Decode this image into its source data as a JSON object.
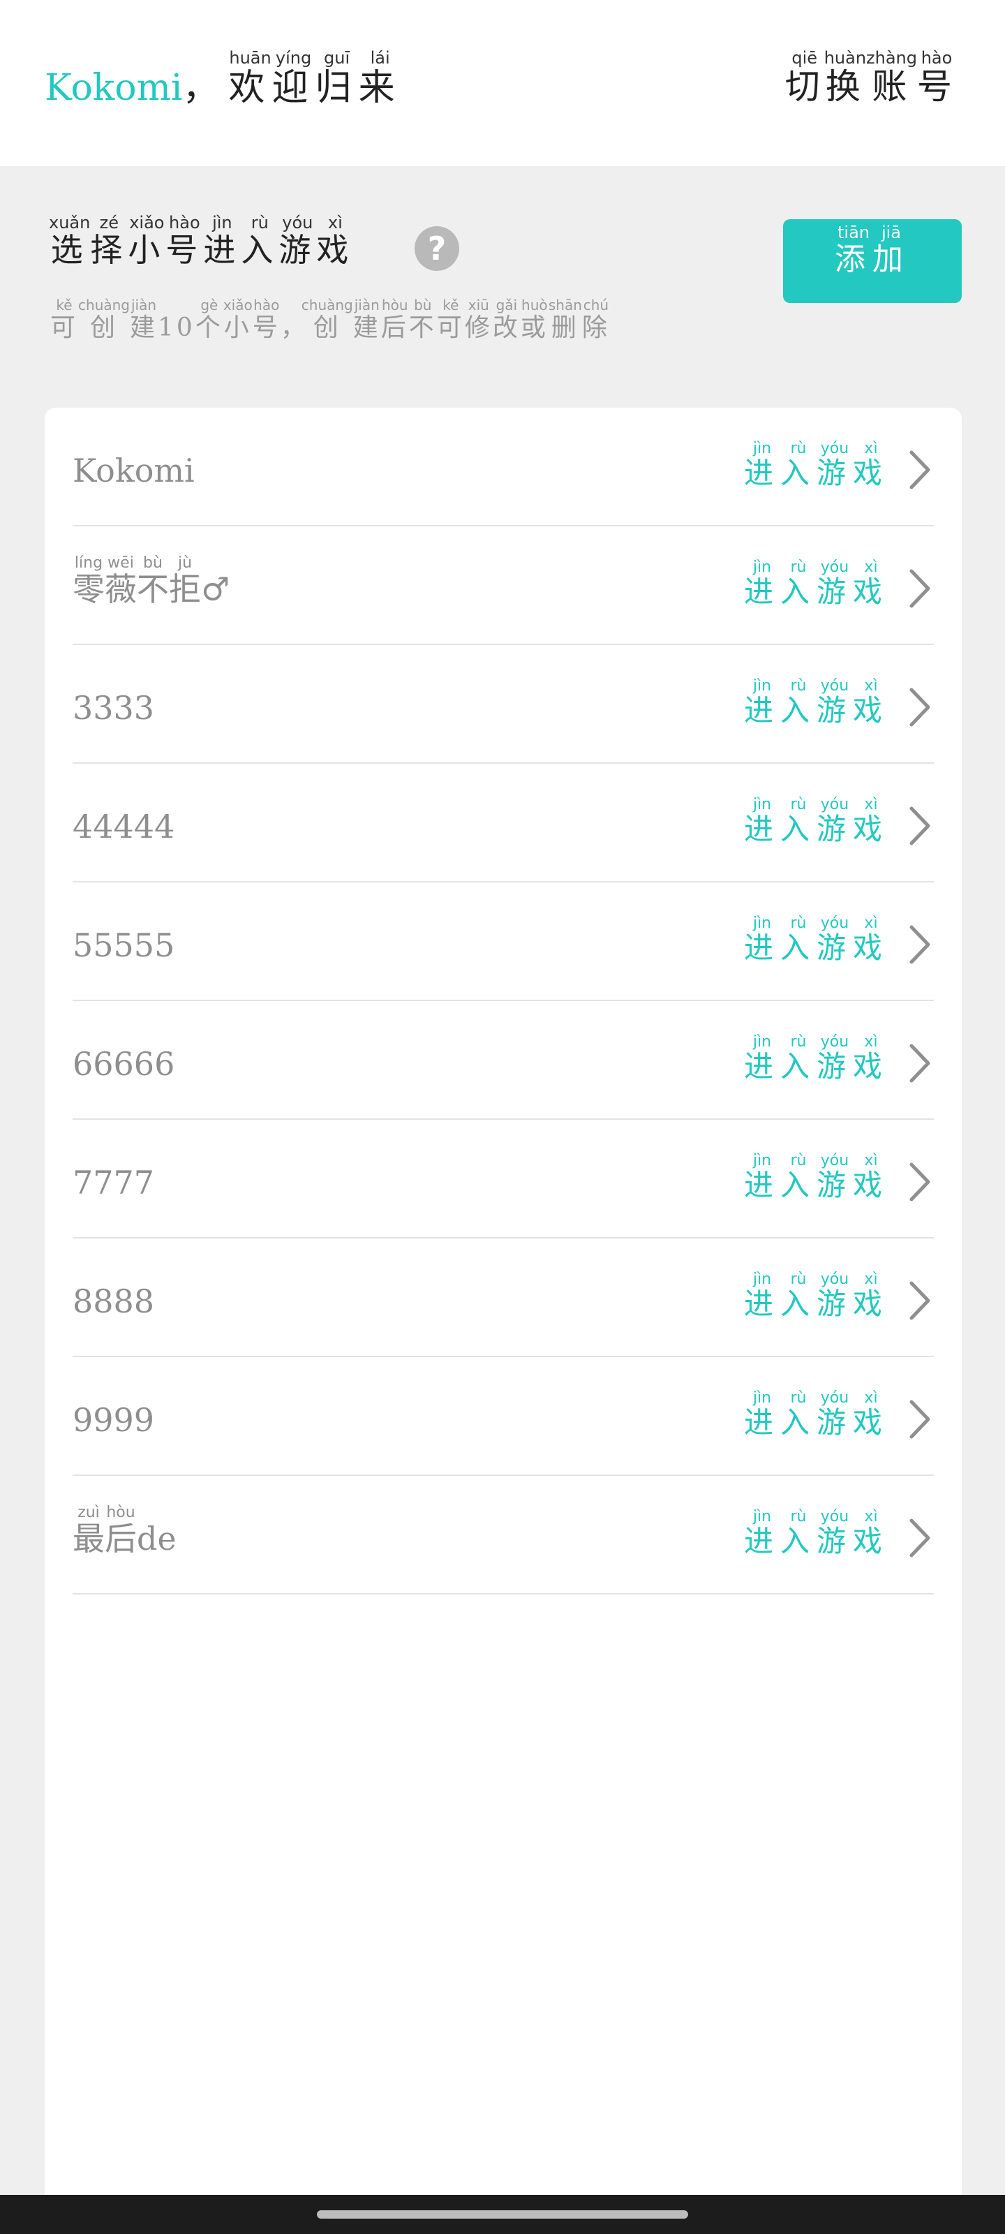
{
  "header": {
    "user_name": "Kokomi",
    "comma": "，",
    "welcome": [
      {
        "char": "欢",
        "pinyin": "huān"
      },
      {
        "char": "迎",
        "pinyin": "yíng"
      },
      {
        "char": "归",
        "pinyin": "guī"
      },
      {
        "char": "来",
        "pinyin": "lái"
      }
    ],
    "switch_account": [
      {
        "char": "切",
        "pinyin": "qiē"
      },
      {
        "char": "换",
        "pinyin": "huàn"
      },
      {
        "char": "账",
        "pinyin": "zhàng"
      },
      {
        "char": "号",
        "pinyin": "hào"
      }
    ]
  },
  "select_section": {
    "title": [
      {
        "char": "选",
        "pinyin": "xuǎn"
      },
      {
        "char": "择",
        "pinyin": "zé"
      },
      {
        "char": "小",
        "pinyin": "xiǎo"
      },
      {
        "char": "号",
        "pinyin": "hào"
      },
      {
        "char": "进",
        "pinyin": "jìn"
      },
      {
        "char": "入",
        "pinyin": "rù"
      },
      {
        "char": "游",
        "pinyin": "yóu"
      },
      {
        "char": "戏",
        "pinyin": "xì"
      }
    ],
    "help_icon": "question-mark-icon",
    "hint": [
      {
        "char": "可",
        "pinyin": "kě"
      },
      {
        "char": "创",
        "pinyin": "chuàng"
      },
      {
        "char": "建",
        "pinyin": "jiàn"
      },
      {
        "char": "10",
        "pinyin": ""
      },
      {
        "char": "个",
        "pinyin": "gè"
      },
      {
        "char": "小",
        "pinyin": "xiǎo"
      },
      {
        "char": "号",
        "pinyin": "hào"
      },
      {
        "char": "，",
        "pinyin": ""
      },
      {
        "char": "创",
        "pinyin": "chuàng"
      },
      {
        "char": "建",
        "pinyin": "jiàn"
      },
      {
        "char": "后",
        "pinyin": "hòu"
      },
      {
        "char": "不",
        "pinyin": "bù"
      },
      {
        "char": "可",
        "pinyin": "kě"
      },
      {
        "char": "修",
        "pinyin": "xiū"
      },
      {
        "char": "改",
        "pinyin": "gǎi"
      },
      {
        "char": "或",
        "pinyin": "huò"
      },
      {
        "char": "删",
        "pinyin": "shān"
      },
      {
        "char": "除",
        "pinyin": "chú"
      }
    ],
    "add_button": [
      {
        "char": "添",
        "pinyin": "tiān"
      },
      {
        "char": "加",
        "pinyin": "jiā"
      }
    ]
  },
  "enter_game": [
    {
      "char": "进",
      "pinyin": "jìn"
    },
    {
      "char": "入",
      "pinyin": "rù"
    },
    {
      "char": "游",
      "pinyin": "yóu"
    },
    {
      "char": "戏",
      "pinyin": "xì"
    }
  ],
  "accounts": [
    {
      "name": [
        {
          "char": "Kokomi",
          "pinyin": ""
        }
      ]
    },
    {
      "name": [
        {
          "char": "零",
          "pinyin": "líng"
        },
        {
          "char": "薇",
          "pinyin": "wēi"
        },
        {
          "char": "不",
          "pinyin": "bù"
        },
        {
          "char": "拒",
          "pinyin": "jù"
        },
        {
          "char": "♂",
          "pinyin": ""
        }
      ]
    },
    {
      "name": [
        {
          "char": "3333",
          "pinyin": ""
        }
      ]
    },
    {
      "name": [
        {
          "char": "44444",
          "pinyin": ""
        }
      ]
    },
    {
      "name": [
        {
          "char": "55555",
          "pinyin": ""
        }
      ]
    },
    {
      "name": [
        {
          "char": "66666",
          "pinyin": ""
        }
      ]
    },
    {
      "name": [
        {
          "char": "7777",
          "pinyin": ""
        }
      ]
    },
    {
      "name": [
        {
          "char": "8888",
          "pinyin": ""
        }
      ]
    },
    {
      "name": [
        {
          "char": "9999",
          "pinyin": ""
        }
      ]
    },
    {
      "name": [
        {
          "char": "最",
          "pinyin": "zuì"
        },
        {
          "char": "后",
          "pinyin": "hòu"
        },
        {
          "char": "de",
          "pinyin": ""
        }
      ]
    }
  ],
  "row_chevron_icon": "chevron-right-icon",
  "colors": {
    "accent": "#23c8c0",
    "page_bg": "#efefef",
    "muted_text": "#8e8e8e"
  }
}
